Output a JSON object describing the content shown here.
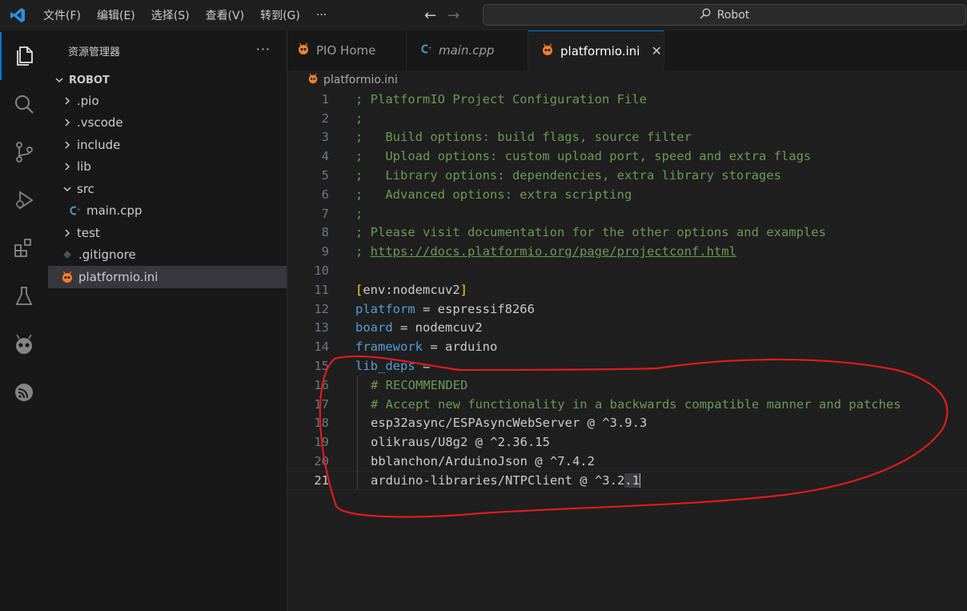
{
  "titlebar": {
    "menus": [
      "文件(F)",
      "编辑(E)",
      "选择(S)",
      "查看(V)",
      "转到(G)"
    ],
    "more": "···",
    "search_text": "Robot"
  },
  "activity": [
    "explorer-icon",
    "search-icon",
    "source-control-icon",
    "run-debug-icon",
    "extensions-icon",
    "testing-icon",
    "platformio-icon",
    "esp-icon"
  ],
  "sidebar": {
    "title": "资源管理器",
    "more": "···",
    "root": "ROBOT",
    "items": [
      {
        "label": ".pio"
      },
      {
        "label": ".vscode"
      },
      {
        "label": "include"
      },
      {
        "label": "lib"
      },
      {
        "label": "src"
      },
      {
        "label": "main.cpp"
      },
      {
        "label": "test"
      },
      {
        "label": ".gitignore"
      },
      {
        "label": "platformio.ini"
      }
    ]
  },
  "tabs": [
    {
      "label": "PIO Home"
    },
    {
      "label": "main.cpp"
    },
    {
      "label": "platformio.ini"
    }
  ],
  "breadcrumb": "platformio.ini",
  "editor": {
    "lines": [
      "; PlatformIO Project Configuration File",
      ";",
      ";   Build options: build flags, source filter",
      ";   Upload options: custom upload port, speed and extra flags",
      ";   Library options: dependencies, extra library storages",
      ";   Advanced options: extra scripting",
      ";",
      "; Please visit documentation for the other options and examples",
      "https://docs.platformio.org/page/projectconf.html",
      "",
      "env:nodemcuv2",
      "espressif8266",
      "nodemcuv2",
      "arduino",
      "",
      "# RECOMMENDED",
      "# Accept new functionality in a backwards compatible manner and patches",
      "esp32async/ESPAsyncWebServer @ ^3.9.3",
      "olikraus/U8g2 @ ^2.36.15",
      "bblanchon/ArduinoJson @ ^7.4.2",
      "arduino-libraries/NTPClient @ ^3.2",
      ".1"
    ],
    "keys": {
      "platform": "platform",
      "board": "board",
      "framework": "framework",
      "lib_deps": "lib_deps"
    },
    "eq": " = ",
    "line_numbers": [
      "1",
      "2",
      "3",
      "4",
      "5",
      "6",
      "7",
      "8",
      "9",
      "10",
      "11",
      "12",
      "13",
      "14",
      "15",
      "16",
      "17",
      "18",
      "19",
      "20",
      "21"
    ],
    "link_prefix": "; ",
    "bracket_open": "[",
    "bracket_close": "]"
  },
  "colors": {
    "comment": "#6a9955",
    "key": "#569cd6",
    "accent": "#0078d4",
    "annotation": "#e01b1b"
  }
}
